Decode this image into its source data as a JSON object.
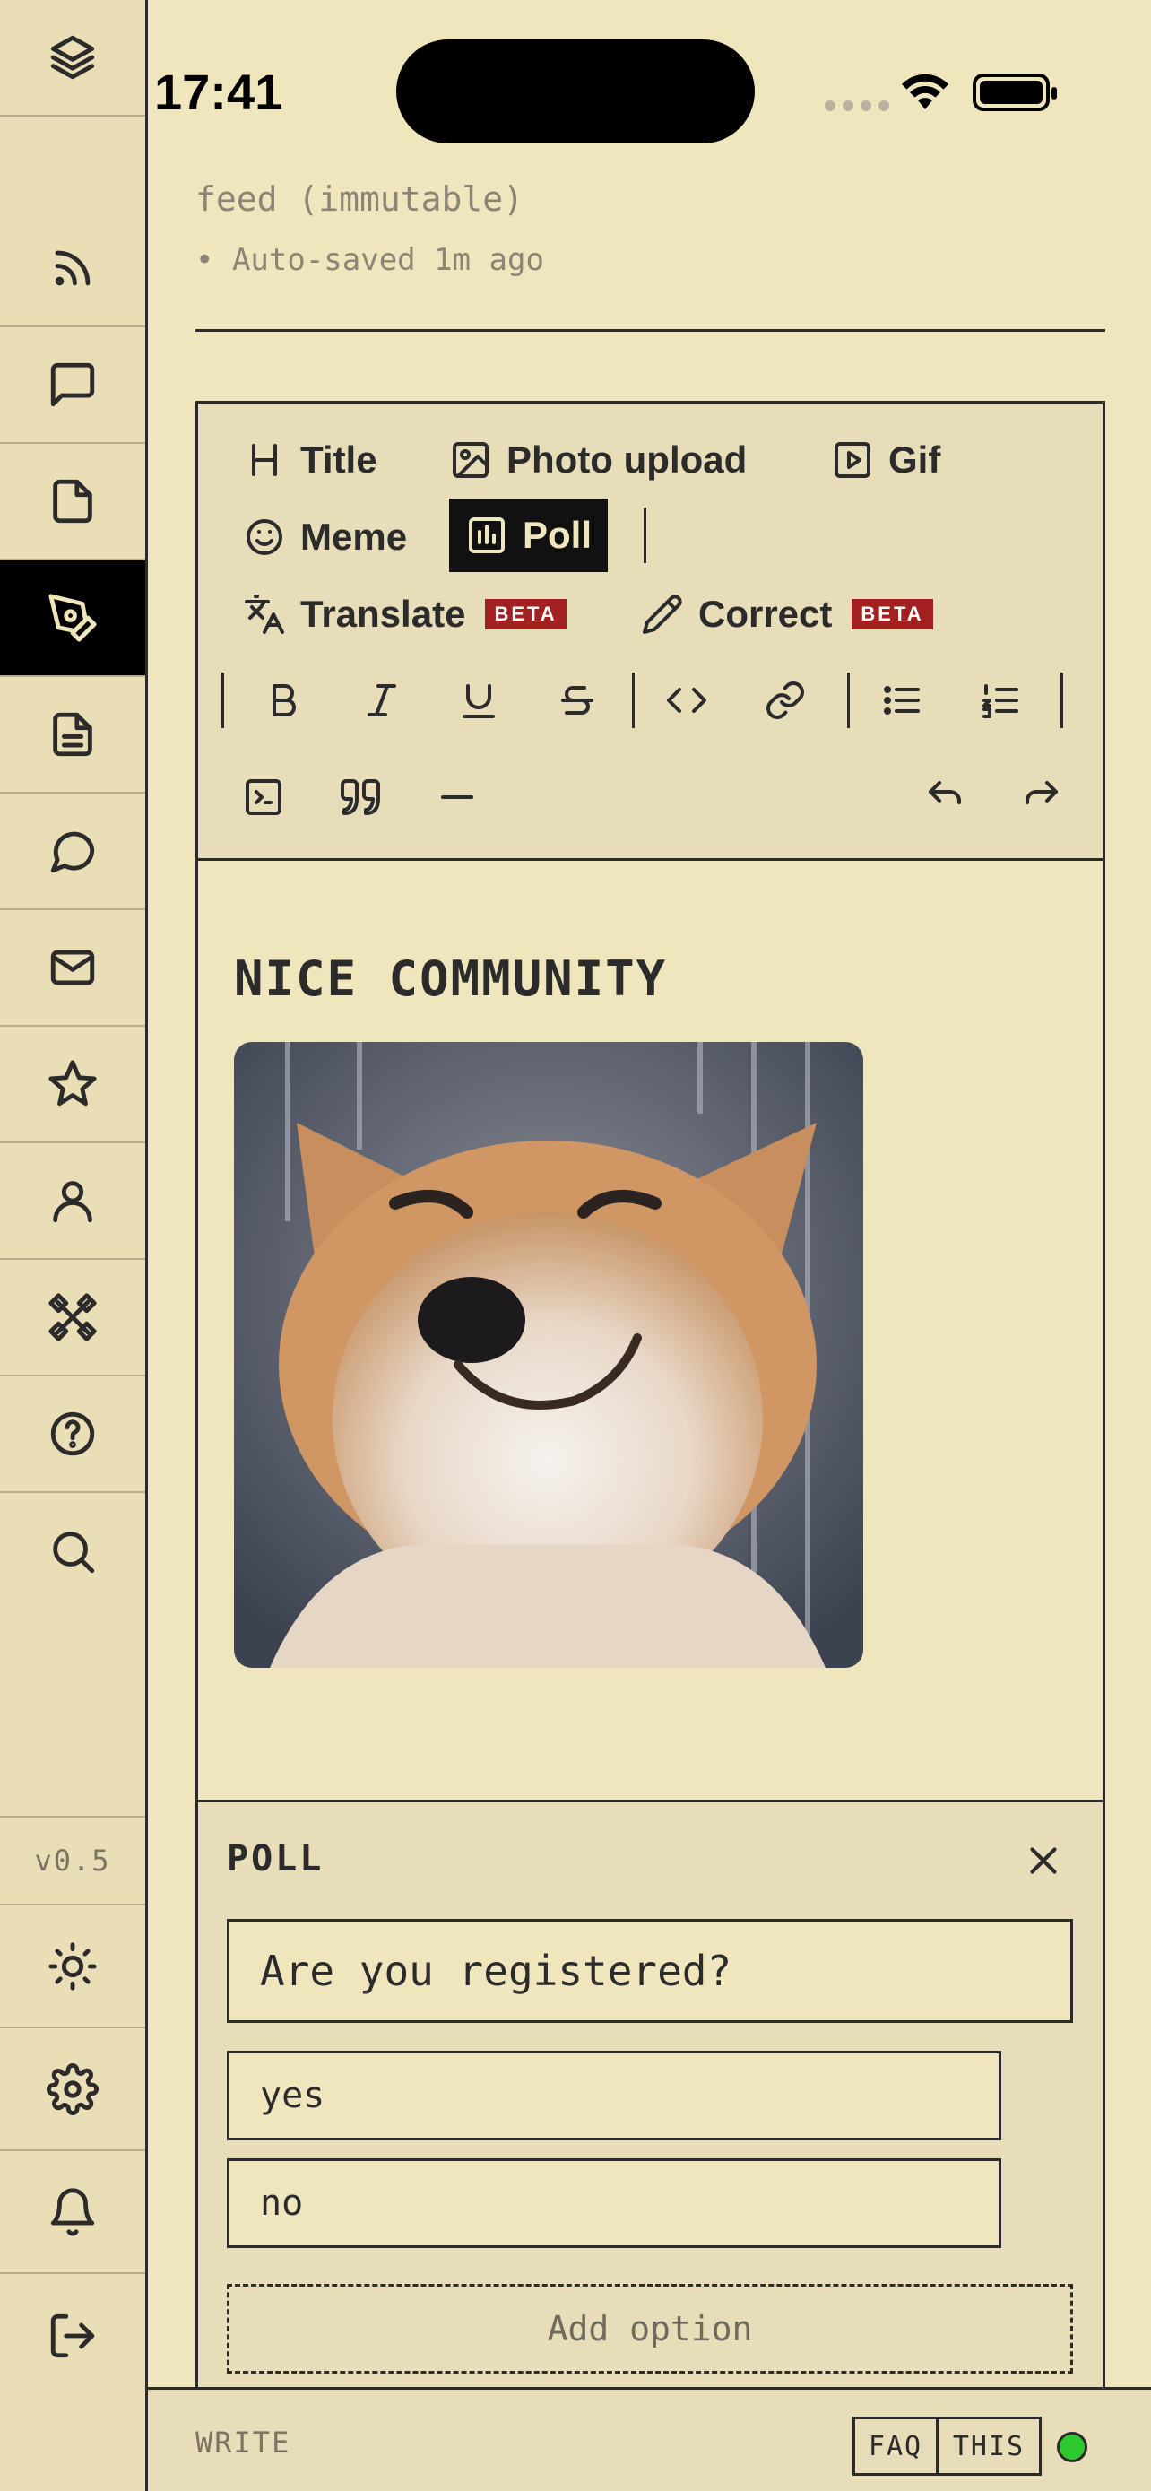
{
  "status_bar": {
    "time": "17:41"
  },
  "header": {
    "feed": "feed (immutable)",
    "autosave": "• Auto-saved 1m ago"
  },
  "toolbar": {
    "title": "Title",
    "photo_upload": "Photo upload",
    "gif": "Gif",
    "meme": "Meme",
    "poll": "Poll",
    "translate": "Translate",
    "correct": "Correct",
    "beta": "BETA"
  },
  "content": {
    "title": "NICE COMMUNITY"
  },
  "poll": {
    "label": "POLL",
    "question": "Are you registered?",
    "options": [
      "yes",
      "no"
    ],
    "add_option": "Add option"
  },
  "sidebar": {
    "version": "v0.5"
  },
  "bottom_bar": {
    "label": "WRITE",
    "faq": "FAQ",
    "this": "THIS"
  },
  "colors": {
    "background": "#f0e6bd",
    "panel": "#e7ddb8",
    "active": "#000000",
    "beta_badge": "#a32020",
    "status_online": "#2ec92e"
  }
}
